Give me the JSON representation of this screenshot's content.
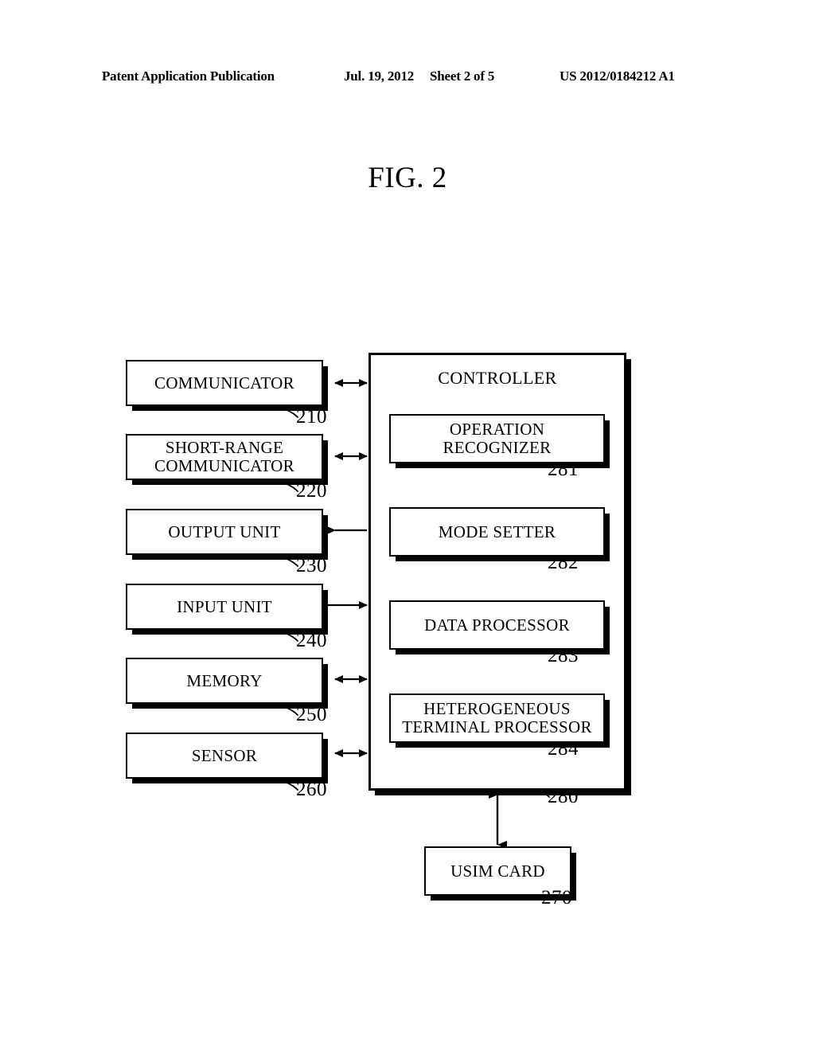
{
  "header": {
    "publication": "Patent Application Publication",
    "date": "Jul. 19, 2012",
    "sheet": "Sheet 2 of 5",
    "doc_number": "US 2012/0184212 A1"
  },
  "figure": {
    "title": "FIG. 2"
  },
  "diagram": {
    "type": "block-diagram",
    "left_column": [
      {
        "label": "COMMUNICATOR",
        "ref": "210",
        "link": "bidirectional"
      },
      {
        "label": "SHORT-RANGE\nCOMMUNICATOR",
        "ref": "220",
        "link": "bidirectional"
      },
      {
        "label": "OUTPUT UNIT",
        "ref": "230",
        "link": "to-left"
      },
      {
        "label": "INPUT UNIT",
        "ref": "240",
        "link": "to-right"
      },
      {
        "label": "MEMORY",
        "ref": "250",
        "link": "bidirectional"
      },
      {
        "label": "SENSOR",
        "ref": "260",
        "link": "bidirectional"
      }
    ],
    "controller": {
      "label": "CONTROLLER",
      "ref": "280",
      "modules": [
        {
          "label": "OPERATION\nRECOGNIZER",
          "ref": "281"
        },
        {
          "label": "MODE SETTER",
          "ref": "282"
        },
        {
          "label": "DATA PROCESSOR",
          "ref": "283"
        },
        {
          "label": "HETEROGENEOUS\nTERMINAL PROCESSOR",
          "ref": "284"
        }
      ]
    },
    "usim": {
      "label": "USIM CARD",
      "ref": "270",
      "link": "bidirectional"
    },
    "colors": {
      "ink": "#000000",
      "paper": "#ffffff"
    }
  }
}
